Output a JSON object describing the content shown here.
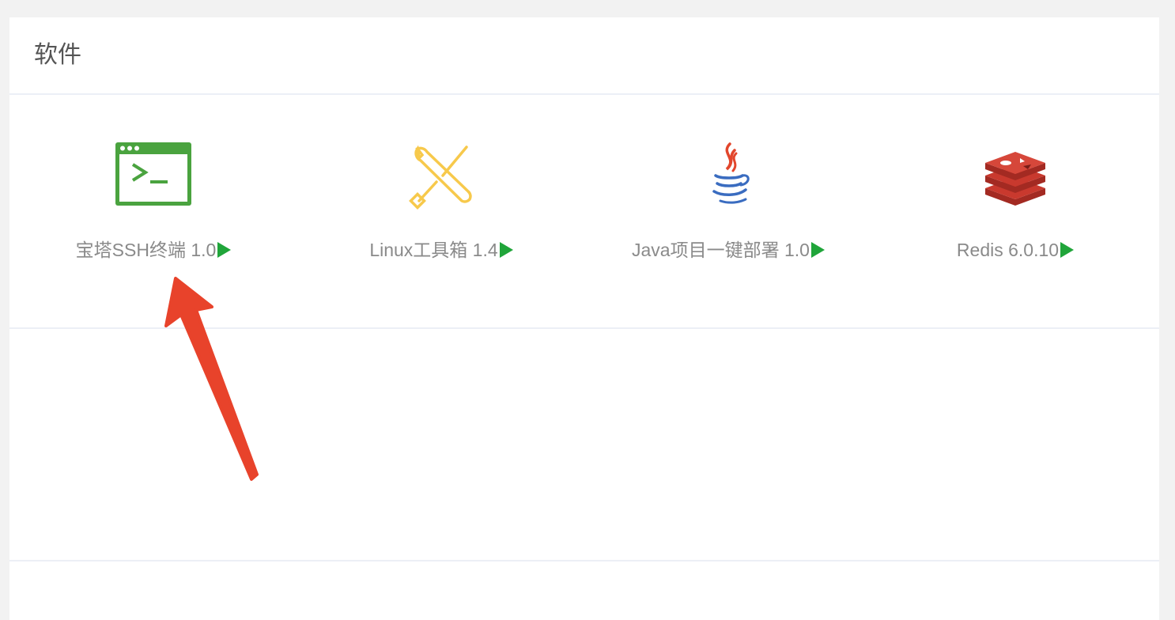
{
  "section": {
    "title": "软件"
  },
  "apps": [
    {
      "label": "宝塔SSH终端 1.0",
      "icon": "terminal-icon"
    },
    {
      "label": "Linux工具箱 1.4",
      "icon": "tools-icon"
    },
    {
      "label": "Java项目一键部署 1.0",
      "icon": "java-icon"
    },
    {
      "label": "Redis 6.0.10",
      "icon": "redis-icon"
    }
  ],
  "colors": {
    "terminal_green": "#4aa33f",
    "tools_yellow": "#f7c94b",
    "java_red": "#e2462c",
    "java_blue": "#3a6cc0",
    "redis_red": "#b8322a",
    "play_green": "#20a53a",
    "annotation_arrow": "#e8432b"
  }
}
